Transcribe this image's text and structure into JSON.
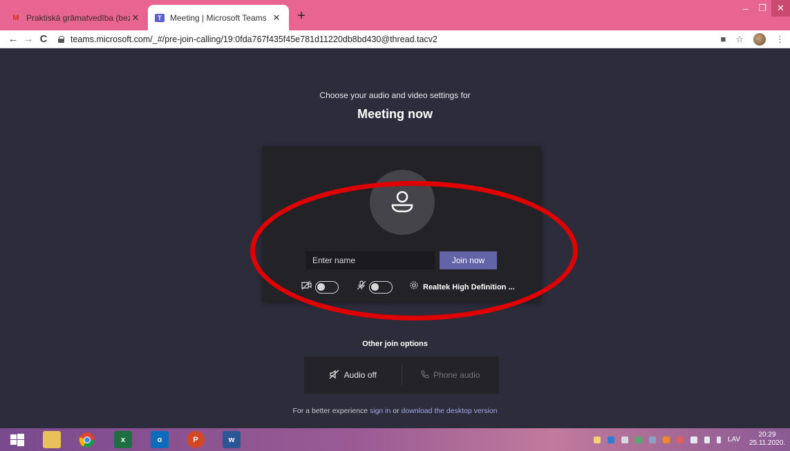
{
  "browser": {
    "tabs": [
      {
        "title": "Praktiskā grāmatvedība (bez pri",
        "close": "✕"
      },
      {
        "title": "Meeting | Microsoft Teams",
        "close": "✕"
      }
    ],
    "new_tab": "+",
    "window_controls": {
      "minimize": "–",
      "maximize": "❐",
      "close": "✕"
    },
    "nav": {
      "back": "←",
      "forward": "→",
      "reload": "C"
    },
    "url": "teams.microsoft.com/_#/pre-join-calling/19:0fda767f435f45e781d11220db8bd430@thread.tacv2",
    "right_icons": {
      "camera": "■",
      "star": "☆",
      "menu": "⋮"
    }
  },
  "prejoin": {
    "prompt": "Choose your audio and video settings for",
    "meeting_title": "Meeting now",
    "name_placeholder": "Enter name",
    "join_label": "Join now",
    "device_label": "Realtek High Definition ..."
  },
  "other_options": {
    "title": "Other join options",
    "audio_off": "Audio off",
    "phone_audio": "Phone audio"
  },
  "footer": {
    "prefix": "For a better experience ",
    "sign_in": "sign in",
    "middle": " or ",
    "download": "download the desktop version"
  },
  "taskbar": {
    "language": "LAV",
    "time": "20:29",
    "date": "25.11.2020."
  },
  "colors": {
    "tab_bar": "#e86591",
    "teams_bg": "#2d2c3a",
    "join_button": "#6264a7",
    "annotation_ring": "#e00000"
  }
}
